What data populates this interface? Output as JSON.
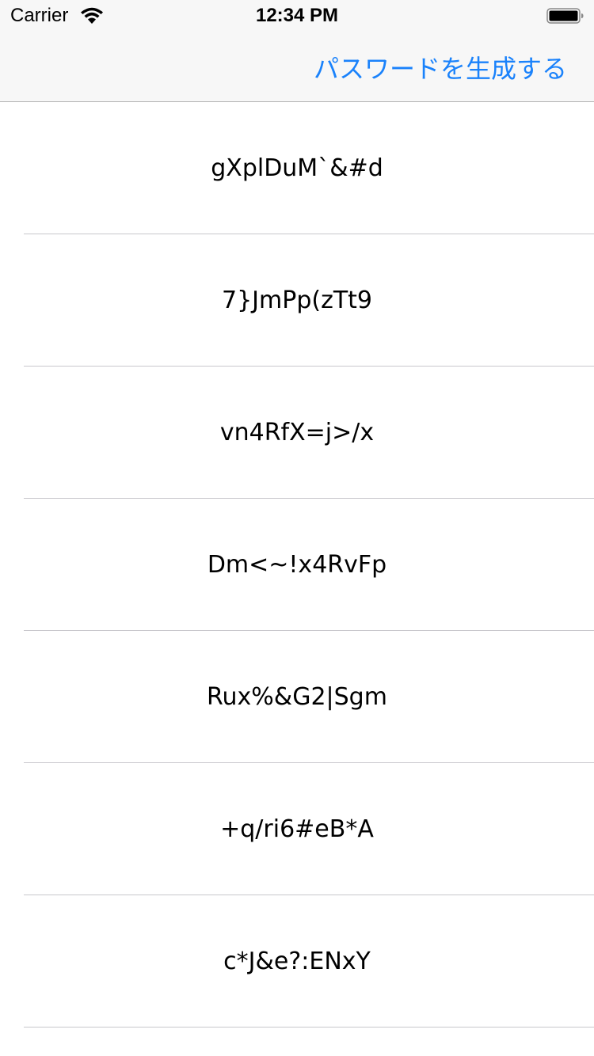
{
  "status_bar": {
    "carrier": "Carrier",
    "time": "12:34 PM",
    "wifi_icon": "wifi-icon",
    "battery_icon": "battery-icon"
  },
  "nav_bar": {
    "action_label": "パスワードを生成する",
    "accent_color": "#1a82fb"
  },
  "passwords": [
    "gXplDuM`&#d",
    "7}JmPp(zTt9",
    "vn4RfX=j>/x",
    "Dm<~!x4RvFp",
    "Rux%&G2|Sgm",
    "+q/ri6#eB*A",
    "c*J&e?:ENxY"
  ]
}
